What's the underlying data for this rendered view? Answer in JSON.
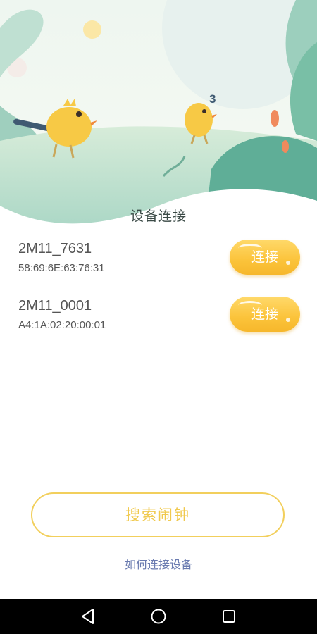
{
  "header": {
    "title": "设备连接"
  },
  "devices": [
    {
      "name": "2M11_7631",
      "mac": "58:69:6E:63:76:31",
      "action_label": "连接"
    },
    {
      "name": "2M11_0001",
      "mac": "A4:1A:02:20:00:01",
      "action_label": "连接"
    }
  ],
  "actions": {
    "search_label": "搜索闹钟",
    "help_link": "如何连接设备"
  },
  "illustration": {
    "chick_number": "3"
  },
  "icons": {
    "back": "back-triangle-icon",
    "home": "home-circle-icon",
    "recents": "recents-square-icon"
  },
  "colors": {
    "accent_yellow": "#fbc33a",
    "search_border": "#f2cf5c",
    "link_blue": "#6a7bb0",
    "teal": "#8cc7b3"
  }
}
